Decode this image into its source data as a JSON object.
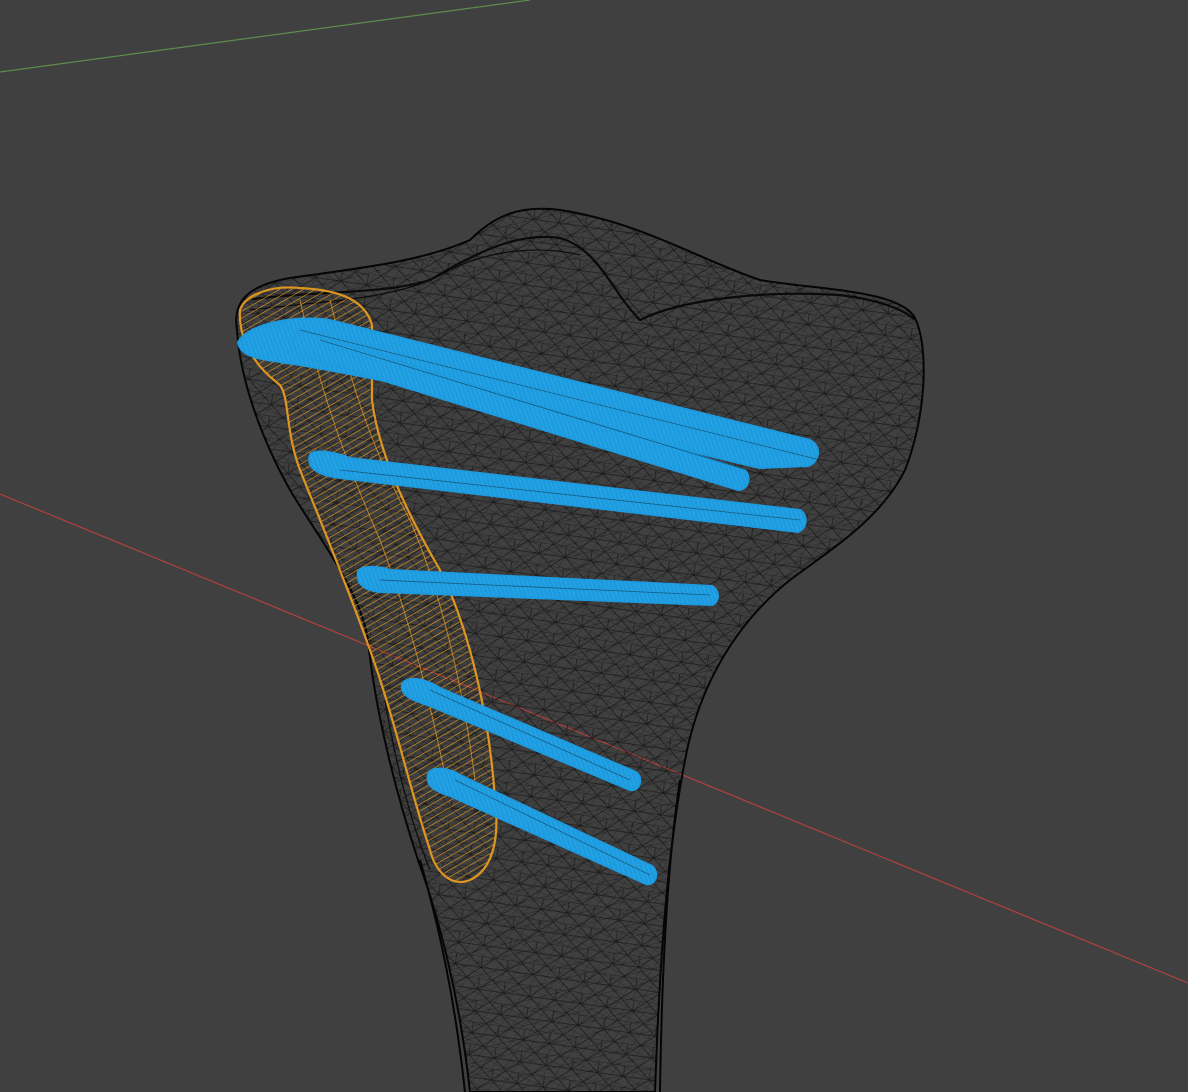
{
  "app": "3D viewport",
  "view": {
    "shading": "wireframe",
    "background_color": "#404040",
    "axes": {
      "x_axis_color": "#b0413e",
      "y_axis_color": "#5e8c4a"
    }
  },
  "objects": [
    {
      "name": "bone-mesh",
      "type": "mesh",
      "wire_color": "#000000"
    },
    {
      "name": "plate",
      "type": "mesh",
      "wire_color": "#f0a020",
      "selected": true
    },
    {
      "name": "screw-1",
      "type": "mesh",
      "wire_color": "#1e9bdf",
      "selected": true
    },
    {
      "name": "screw-2",
      "type": "mesh",
      "wire_color": "#1e9bdf",
      "selected": true
    },
    {
      "name": "screw-3",
      "type": "mesh",
      "wire_color": "#1e9bdf",
      "selected": true
    },
    {
      "name": "screw-4",
      "type": "mesh",
      "wire_color": "#1e9bdf",
      "selected": true
    },
    {
      "name": "screw-5",
      "type": "mesh",
      "wire_color": "#1e9bdf",
      "selected": true
    },
    {
      "name": "screw-6",
      "type": "mesh",
      "wire_color": "#1e9bdf",
      "selected": true
    }
  ]
}
